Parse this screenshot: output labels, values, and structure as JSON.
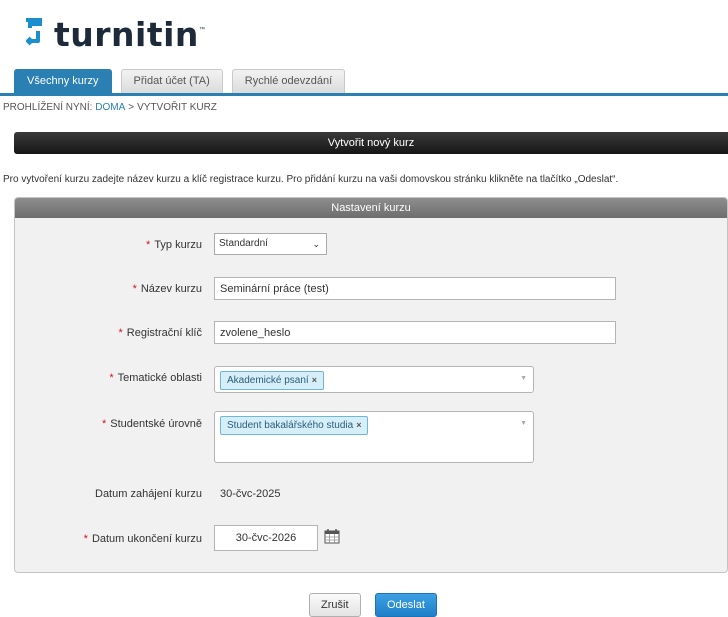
{
  "brand": {
    "name": "turnitin",
    "trademark": "™"
  },
  "tabs": [
    {
      "label": "Všechny kurzy",
      "active": true
    },
    {
      "label": "Přidat účet (TA)",
      "active": false
    },
    {
      "label": "Rychlé odevzdání",
      "active": false
    }
  ],
  "breadcrumb": {
    "prefix": "PROHLÍŽENÍ NYNÍ:",
    "home": "DOMA",
    "separator": ">",
    "current": "VYTVOŘIT KURZ"
  },
  "page_title": "Vytvořit nový kurz",
  "intro": "Pro vytvoření kurzu zadejte název kurzu a klíč registrace kurzu. Pro přidání kurzu na vaši domovskou stránku klikněte na tlačítko „Odeslat“.",
  "panel": {
    "title": "Nastavení kurzu"
  },
  "form": {
    "required_mark": "*",
    "course_type": {
      "label": "Typ kurzu",
      "value": "Standardní"
    },
    "course_name": {
      "label": "Název kurzu",
      "value": "Seminární práce (test)"
    },
    "enrollment_key": {
      "label": "Registrační klíč",
      "value": "zvolene_heslo"
    },
    "subject_areas": {
      "label": "Tematické oblasti",
      "tags": [
        "Akademické psaní"
      ]
    },
    "student_levels": {
      "label": "Studentské úrovně",
      "tags": [
        "Student bakalářského studia"
      ]
    },
    "start_date": {
      "label": "Datum zahájení kurzu",
      "value": "30-čvc-2025"
    },
    "end_date": {
      "label": "Datum ukončení kurzu",
      "value": "30-čvc-2026"
    }
  },
  "buttons": {
    "cancel": "Zrušit",
    "submit": "Odeslat"
  },
  "icons": {
    "remove_tag": "×",
    "dropdown": "chevron-down-icon",
    "calendar": "calendar-icon"
  },
  "colors": {
    "accent": "#2a7fb3",
    "required": "#d0141b",
    "tag_bg": "#d6eef8"
  }
}
